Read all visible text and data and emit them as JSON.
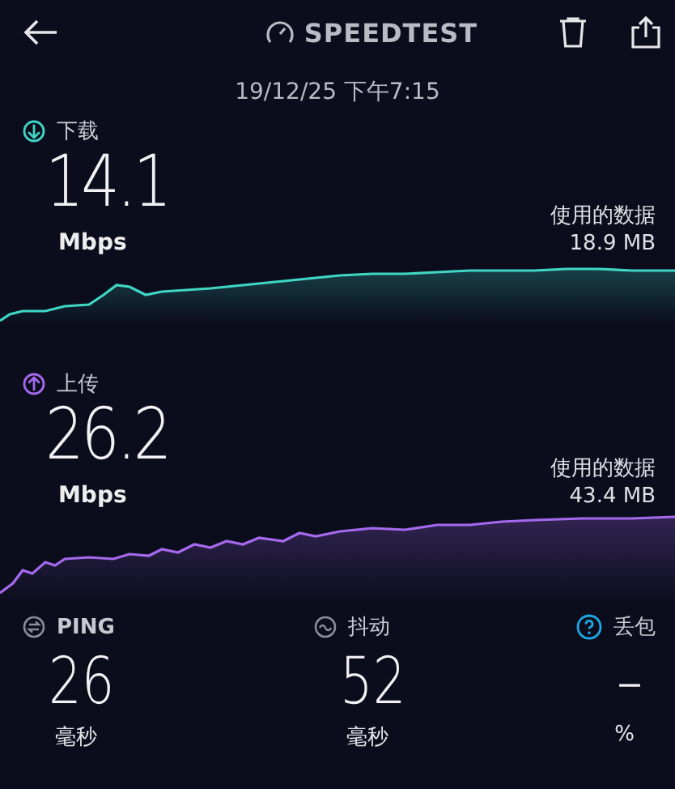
{
  "header": {
    "title": "SPEEDTEST",
    "date": "19/12/25 下午7:15"
  },
  "speeds": [
    {
      "kind": "download",
      "label": "下载",
      "value": "14.1",
      "unit": "Mbps",
      "data_label": "使用的数据",
      "data_value": "18.9 MB",
      "color": "#3fd6c6"
    },
    {
      "kind": "upload",
      "label": "上传",
      "value": "26.2",
      "unit": "Mbps",
      "data_label": "使用的数据",
      "data_value": "43.4 MB",
      "color": "#a569ee"
    }
  ],
  "stats": [
    {
      "kind": "ping",
      "label": "PING",
      "value": "26",
      "unit": "毫秒"
    },
    {
      "kind": "jitter",
      "label": "抖动",
      "value": "52",
      "unit": "毫秒"
    },
    {
      "kind": "loss",
      "label": "丢包",
      "value": "–",
      "unit": "%"
    }
  ]
}
